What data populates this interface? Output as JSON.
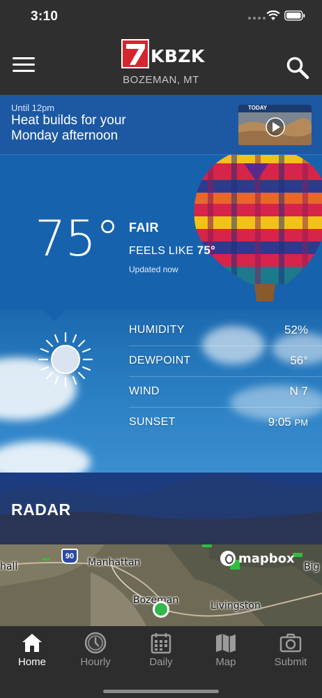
{
  "status_bar": {
    "time": "3:10"
  },
  "header": {
    "logo_number": "7",
    "logo_text": "KBZK",
    "location": "BOZEMAN, MT",
    "icons": {
      "menu": "hamburger-menu-icon",
      "search": "search-icon"
    }
  },
  "banner": {
    "eyebrow": "Until 12pm",
    "headline": "Heat builds for your Monday afternoon",
    "thumbnail_caption": "TODAY"
  },
  "current": {
    "temperature": "75°",
    "condition": "FAIR",
    "feels_like_label": "FEELS LIKE",
    "feels_like_value": "75°",
    "updated": "Updated now",
    "icon": "sunny-icon"
  },
  "stats": [
    {
      "label": "HUMIDITY",
      "value": "52%",
      "unit": ""
    },
    {
      "label": "DEWPOINT",
      "value": "56°",
      "unit": ""
    },
    {
      "label": "WIND",
      "value": "N 7",
      "unit": ""
    },
    {
      "label": "SUNSET",
      "value": "9:05",
      "unit": "PM"
    }
  ],
  "radar": {
    "title": "RADAR",
    "attribution": "mapbox",
    "highway": "90",
    "places": [
      "hall",
      "Manhattan",
      "Bozeman",
      "Livingston",
      "Big"
    ]
  },
  "tabs": [
    {
      "label": "Home",
      "icon": "home-icon",
      "active": true
    },
    {
      "label": "Hourly",
      "icon": "clock-icon",
      "active": false
    },
    {
      "label": "Daily",
      "icon": "calendar-icon",
      "active": false
    },
    {
      "label": "Map",
      "icon": "map-icon",
      "active": false
    },
    {
      "label": "Submit",
      "icon": "camera-icon",
      "active": false
    }
  ],
  "colors": {
    "brand_red": "#d5262f",
    "banner_blue": "#1d58a3",
    "panel_blue": "#1762ad",
    "location_green": "#2fb84b"
  }
}
